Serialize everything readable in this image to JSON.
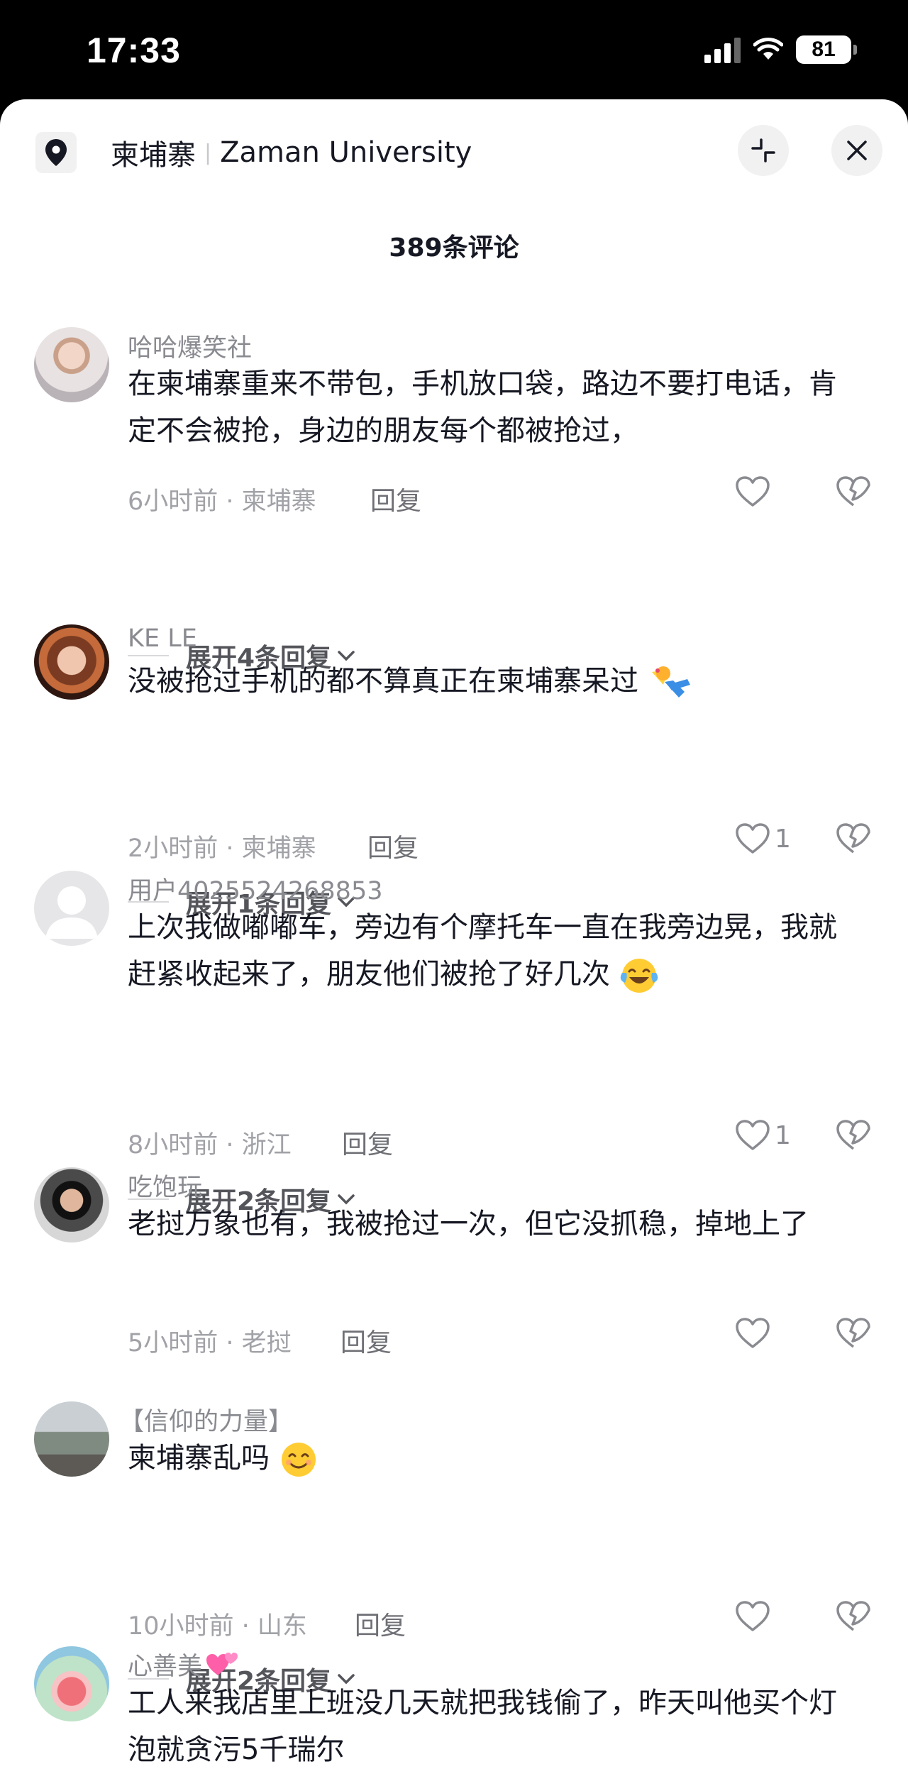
{
  "status_bar": {
    "time": "17:33",
    "battery": "81"
  },
  "header": {
    "location_prefix": "柬埔寨",
    "location_name": "Zaman University"
  },
  "comment_count": "389条评论",
  "comments": [
    {
      "username": "哈哈爆笑社",
      "text": "在柬埔寨重来不带包，手机放口袋，路边不要打电话，肯定不会被抢，身边的朋友每个都被抢过，",
      "meta": "6小时前 · 柬埔寨",
      "reply_label": "回复",
      "likes": "",
      "expand_label": "展开4条回复"
    },
    {
      "username": "KE LE",
      "text": "没被抢过手机的都不算真正在柬埔寨呆过",
      "meta": "2小时前 · 柬埔寨",
      "reply_label": "回复",
      "likes": "1",
      "expand_label": "展开1条回复"
    },
    {
      "username": "用户4025524268853",
      "text": "上次我做嘟嘟车，旁边有个摩托车一直在我旁边晃，我就赶紧收起来了，朋友他们被抢了好几次",
      "meta": "8小时前 · 浙江",
      "reply_label": "回复",
      "likes": "1",
      "expand_label": "展开2条回复"
    },
    {
      "username": "吃饱玩",
      "text": "老挝万象也有，我被抢过一次，但它没抓稳，掉地上了",
      "meta": "5小时前 · 老挝",
      "reply_label": "回复",
      "likes": ""
    },
    {
      "username": "【信仰的力量】",
      "text": "柬埔寨乱吗",
      "meta": "10小时前 · 山东",
      "reply_label": "回复",
      "likes": "",
      "expand_label": "展开2条回复"
    },
    {
      "username": "心善美",
      "text": "工人来我店里上班没几天就把我钱偷了，昨天叫他买个灯泡就贪污5千瑞尔"
    }
  ]
}
